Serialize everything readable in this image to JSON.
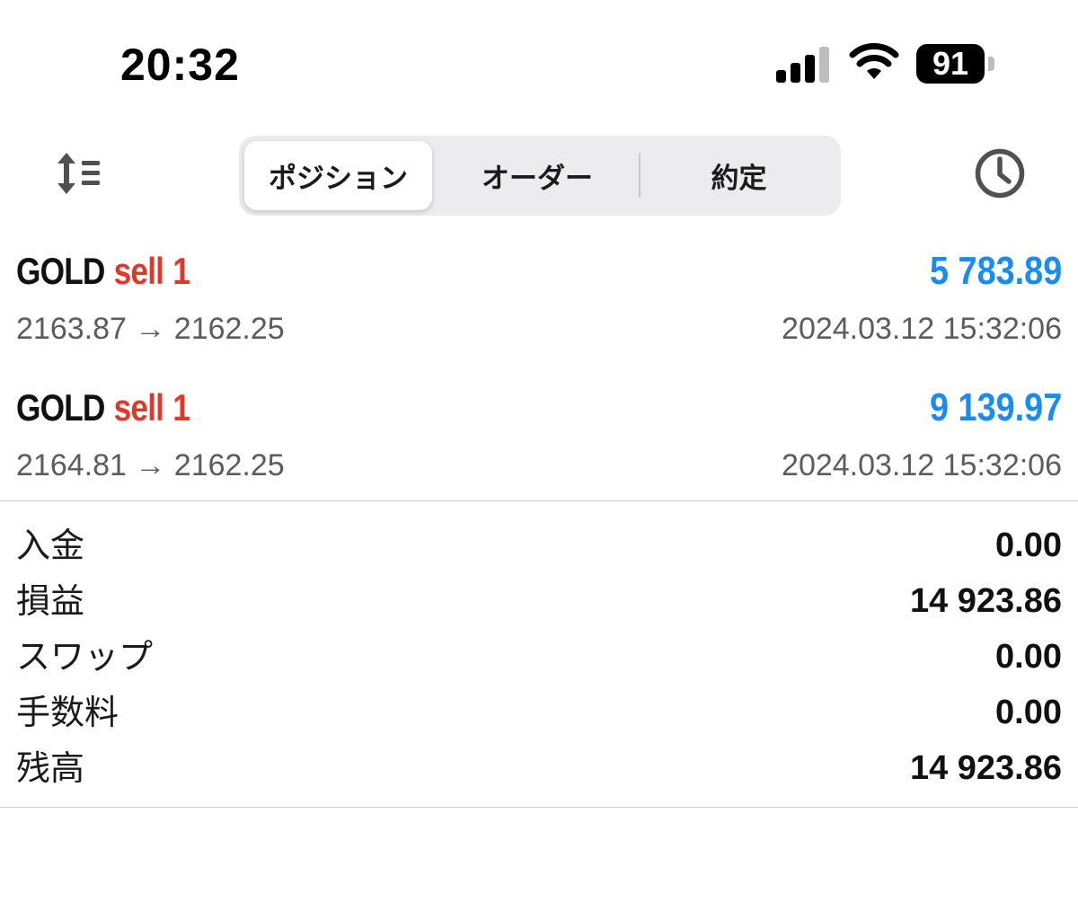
{
  "status_bar": {
    "time": "20:32",
    "battery": "91",
    "icons": [
      "cellular-signal-icon",
      "wifi-icon",
      "battery-icon"
    ]
  },
  "toolbar": {
    "left_icon": "sort-icon",
    "right_icon": "clock-icon",
    "tabs": [
      {
        "label": "ポジション",
        "active": true
      },
      {
        "label": "オーダー",
        "active": false
      },
      {
        "label": "約定",
        "active": false
      }
    ]
  },
  "positions": [
    {
      "symbol": "GOLD",
      "side": "sell",
      "volume": "1",
      "profit": "5 783.89",
      "prices": "2163.87 → 2162.25",
      "time": "2024.03.12 15:32:06"
    },
    {
      "symbol": "GOLD",
      "side": "sell",
      "volume": "1",
      "profit": "9 139.97",
      "prices": "2164.81 → 2162.25",
      "time": "2024.03.12 15:32:06"
    }
  ],
  "summary": [
    {
      "label": "入金",
      "value": "0.00"
    },
    {
      "label": "損益",
      "value": "14 923.86"
    },
    {
      "label": "スワップ",
      "value": "0.00"
    },
    {
      "label": "手数料",
      "value": "0.00"
    },
    {
      "label": "残高",
      "value": "14 923.86"
    }
  ],
  "colors": {
    "profit": "#1a8cf0",
    "sell": "#e0392b",
    "secondary_text": "#5c5c5c",
    "segment_bg": "#ececee"
  }
}
